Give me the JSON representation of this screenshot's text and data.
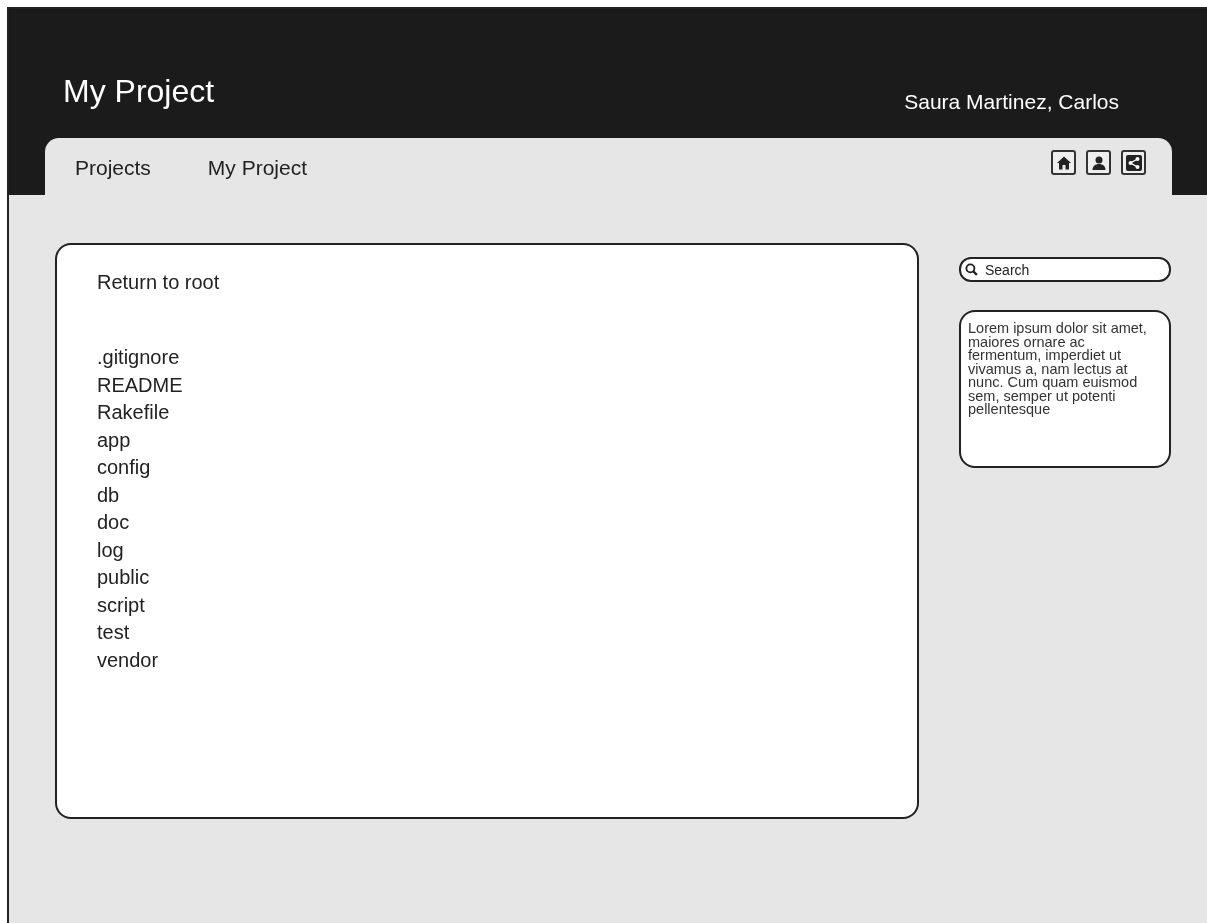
{
  "header": {
    "title": "My Project",
    "user": "Saura Martinez, Carlos"
  },
  "tabs": [
    {
      "label": "Projects",
      "selected": false
    },
    {
      "label": "My Project",
      "selected": false
    }
  ],
  "toolbar": [
    {
      "kind": "home"
    },
    {
      "kind": "user"
    },
    {
      "kind": "share"
    }
  ],
  "files": {
    "return_link": "Return to root",
    "items": [
      ".gitignore",
      "README",
      "Rakefile",
      "app",
      "config",
      "db",
      "doc",
      "log",
      "public",
      "script",
      "test",
      "vendor"
    ]
  },
  "search": {
    "placeholder": "Search"
  },
  "note": {
    "text": "Lorem ipsum dolor sit amet, maiores ornare ac fermentum, imperdiet ut vivamus a, nam lectus at nunc. Cum quam euismod sem, semper ut potenti pellentesque"
  }
}
